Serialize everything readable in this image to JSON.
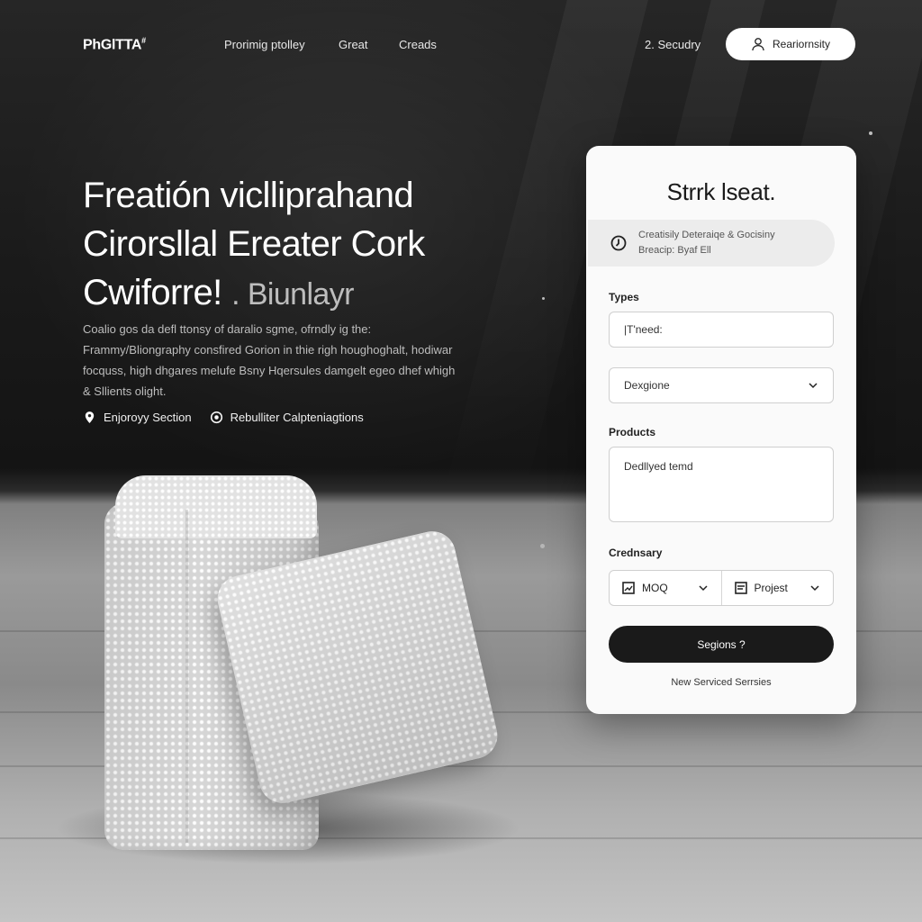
{
  "header": {
    "logo": "PhGlTTA",
    "logo_mark": "#",
    "nav": [
      "Prorimig ptolley",
      "Great",
      "Creads"
    ],
    "secondary_link": "2. Secudry",
    "cta_label": "Reariornsity"
  },
  "hero": {
    "title_line1": "Freatión viclliprahand",
    "title_line2": "Cirorsllal Ereater Cork",
    "title_line3": "Cwiforre!",
    "title_suffix": ". Biunlayr",
    "description": "Coalio gos da defl ttonsy of daralio sgme, ofrndly ig the: Frammy/Bliongraphy consfired Gorion in thie righ houghoghalt, hodiwar focquss, high dhgares melufe Bsny Hqersules damgelt egeo dhef whigh & Sllients olight.",
    "features": [
      {
        "icon": "location-pin-icon",
        "label": "Enjoroyy Section"
      },
      {
        "icon": "gear-badge-icon",
        "label": "Rebulliter Calpteniagtions"
      }
    ]
  },
  "form": {
    "title": "Strrk lseat.",
    "info_line1": "Creatisily Deteraiqe & Gocisiny",
    "info_line2": "Breacip: Byaf Ell",
    "types_label": "Types",
    "need_placeholder": "|T'need:",
    "select_value": "Dexgione",
    "products_label": "Products",
    "products_value": "Dedllyed temd",
    "ordinary_label": "Crednsary",
    "option_left": "MOQ",
    "option_right": "Projest",
    "submit_label": "Segions ?",
    "footer_link": "New Serviced Serrsies"
  },
  "colors": {
    "background": "#1b1b1b",
    "card": "#fafafa",
    "button_dark": "#1a1a1a",
    "text_light": "#ffffff"
  }
}
